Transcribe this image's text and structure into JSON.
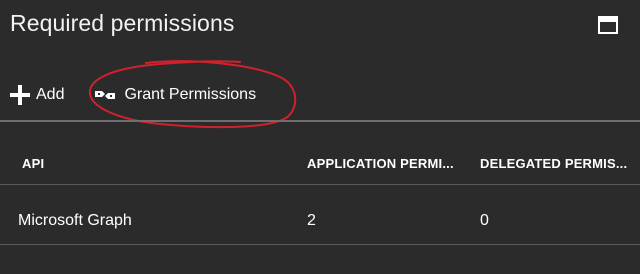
{
  "blade": {
    "title": "Required permissions",
    "maximize_icon": "maximize-icon"
  },
  "toolbar": {
    "add_label": "Add",
    "add_icon": "plus-icon",
    "grant_label": "Grant Permissions",
    "grant_icon": "grant-icon"
  },
  "annotation": {
    "color": "#d0212c",
    "shape": "hand-drawn ellipse around Grant Permissions"
  },
  "table": {
    "columns": [
      "API",
      "APPLICATION PERMI...",
      "DELEGATED PERMIS..."
    ],
    "rows": [
      [
        "Microsoft Graph",
        "2",
        "0"
      ]
    ]
  },
  "colors": {
    "background": "#2b2b2b",
    "text": "#ffffff",
    "divider": "#6e6e6e"
  }
}
